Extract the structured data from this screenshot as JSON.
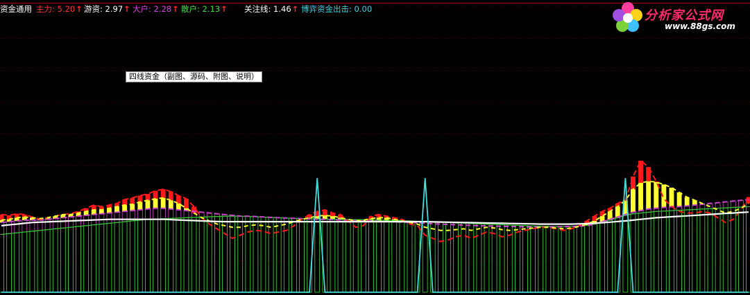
{
  "header": {
    "title": "资金通用",
    "items": [
      {
        "label": "主力: 5.20",
        "arrow": "↑",
        "color": "#ff3030"
      },
      {
        "label": "游资: 2.97",
        "arrow": "↑",
        "color": "#ffffff"
      },
      {
        "label": "大户: 2.28",
        "arrow": "↑",
        "color": "#e040e0"
      },
      {
        "label": "散户: 2.13",
        "arrow": "↑",
        "color": "#40e040"
      },
      {
        "label": "关注线: 1.46",
        "arrow": "↑",
        "color": "#ffffff"
      },
      {
        "label": "博弈资金出击: 0.00",
        "arrow": "",
        "color": "#40d0e0"
      }
    ]
  },
  "tooltip": "四线资金（副图、源码、附图、说明）",
  "logo": {
    "text": "分析家公式网",
    "url": "www.88gs.com"
  },
  "colors": {
    "main_force": "#ff1a1a",
    "hot_money": "#ffff33",
    "big_holder": "#cc44cc",
    "retail": "#33cc33",
    "watch_line": "#ffffff",
    "game_fund": "#44dddd",
    "grid": "#3a0000",
    "border": "#b00000"
  },
  "chart_data": {
    "type": "bar",
    "series": [
      {
        "name": "主力",
        "values": [
          4.9,
          4.85,
          4.95,
          4.9,
          4.75,
          4.6,
          4.7,
          4.8,
          4.9,
          4.95,
          5.1,
          5.3,
          5.5,
          5.4,
          5.5,
          5.6,
          5.85,
          5.95,
          6.1,
          6.2,
          6.4,
          6.5,
          6.35,
          6.1,
          5.9,
          5.4,
          4.7,
          4.3,
          4.0,
          3.7,
          3.4,
          3.6,
          3.8,
          3.9,
          3.85,
          3.7,
          3.8,
          3.9,
          4.2,
          4.6,
          4.9,
          5.1,
          5.2,
          5.0,
          4.9,
          4.5,
          4.1,
          4.2,
          4.8,
          4.9,
          4.8,
          4.7,
          4.6,
          4.3,
          4.2,
          3.6,
          3.4,
          3.2,
          3.3,
          3.5,
          3.6,
          3.4,
          3.6,
          3.8,
          3.7,
          3.5,
          3.6,
          3.8,
          3.9,
          4.0,
          4.1,
          4.1,
          4.0,
          3.9,
          4.0,
          4.2,
          4.5,
          4.8,
          5.1,
          5.3,
          5.6,
          5.8,
          7.3,
          8.3,
          7.9,
          7.0,
          5.9,
          5.4,
          5.1,
          5.0,
          5.0,
          5.1,
          5.0,
          4.7,
          4.4,
          4.6,
          5.2,
          6.0
        ]
      },
      {
        "name": "游资",
        "values": [
          4.55,
          4.6,
          4.7,
          4.75,
          4.7,
          4.65,
          4.7,
          4.8,
          4.9,
          4.9,
          5.0,
          5.1,
          5.2,
          5.2,
          5.3,
          5.4,
          5.5,
          5.55,
          5.7,
          5.8,
          5.9,
          5.95,
          5.8,
          5.6,
          5.3,
          5.0,
          4.7,
          4.5,
          4.3,
          4.2,
          4.1,
          4.1,
          4.2,
          4.25,
          4.2,
          4.1,
          4.2,
          4.3,
          4.45,
          4.6,
          4.7,
          4.8,
          4.85,
          4.8,
          4.7,
          4.6,
          4.5,
          4.55,
          4.65,
          4.7,
          4.7,
          4.6,
          4.5,
          4.4,
          4.3,
          4.1,
          4.0,
          3.9,
          3.9,
          3.95,
          4.0,
          3.9,
          4.0,
          4.1,
          4.05,
          3.95,
          3.9,
          3.95,
          4.0,
          4.05,
          4.1,
          4.1,
          4.05,
          4.0,
          4.05,
          4.15,
          4.3,
          4.5,
          4.8,
          5.1,
          5.4,
          5.8,
          6.5,
          6.9,
          7.0,
          6.95,
          6.8,
          6.6,
          6.3,
          6.0,
          5.8,
          5.6,
          5.4,
          5.2,
          5.0,
          5.1,
          5.3,
          5.6
        ]
      },
      {
        "name": "大户",
        "values": [
          4.4,
          4.45,
          4.5,
          4.55,
          4.55,
          4.55,
          4.6,
          4.65,
          4.7,
          4.75,
          4.8,
          4.85,
          4.9,
          4.95,
          5.0,
          5.05,
          5.1,
          5.15,
          5.2,
          5.25,
          5.3,
          5.3,
          5.25,
          5.2,
          5.15,
          5.1,
          5.05,
          5.0,
          4.95,
          4.9,
          4.85,
          4.8,
          4.8,
          4.78,
          4.75,
          4.72,
          4.7,
          4.68,
          4.66,
          4.64,
          4.62,
          4.6,
          4.6,
          4.58,
          4.56,
          4.54,
          4.52,
          4.5,
          4.5,
          4.48,
          4.46,
          4.44,
          4.42,
          4.4,
          4.38,
          4.35,
          4.32,
          4.3,
          4.28,
          4.26,
          4.24,
          4.22,
          4.2,
          4.18,
          4.17,
          4.16,
          4.15,
          4.14,
          4.13,
          4.12,
          4.12,
          4.12,
          4.13,
          4.14,
          4.15,
          4.17,
          4.2,
          4.3,
          4.45,
          4.6,
          4.75,
          4.9,
          5.05,
          5.15,
          5.25,
          5.3,
          5.35,
          5.4,
          5.4,
          5.45,
          5.5,
          5.55,
          5.6,
          5.65,
          5.7,
          5.75,
          5.8,
          5.85
        ]
      },
      {
        "name": "散户",
        "values": [
          3.65,
          3.7,
          3.75,
          3.8,
          3.85,
          3.9,
          3.95,
          4.0,
          4.05,
          4.1,
          4.15,
          4.2,
          4.25,
          4.3,
          4.35,
          4.4,
          4.45,
          4.5,
          4.55,
          4.6,
          4.62,
          4.64,
          4.66,
          4.68,
          4.7,
          4.72,
          4.74,
          4.76,
          4.78,
          4.8,
          4.8,
          4.8,
          4.78,
          4.76,
          4.74,
          4.72,
          4.7,
          4.68,
          4.66,
          4.65,
          4.64,
          4.63,
          4.62,
          4.61,
          4.6,
          4.59,
          4.58,
          4.57,
          4.56,
          4.55,
          4.54,
          4.53,
          4.52,
          4.5,
          4.48,
          4.46,
          4.44,
          4.42,
          4.4,
          4.38,
          4.36,
          4.34,
          4.32,
          4.3,
          4.28,
          4.26,
          4.24,
          4.22,
          4.2,
          4.18,
          4.17,
          4.16,
          4.15,
          4.15,
          4.16,
          4.18,
          4.22,
          4.3,
          4.4,
          4.55,
          4.7,
          4.85,
          4.95,
          5.0,
          5.05,
          5.1,
          5.12,
          5.15,
          5.17,
          5.2,
          5.22,
          5.25,
          5.27,
          5.3,
          5.32,
          5.35,
          5.37,
          5.4
        ]
      },
      {
        "name": "关注线",
        "values": [
          4.2,
          4.25,
          4.3,
          4.35,
          4.4,
          4.42,
          4.44,
          4.46,
          4.48,
          4.5,
          4.52,
          4.54,
          4.56,
          4.58,
          4.6,
          4.6,
          4.6,
          4.6,
          4.6,
          4.6,
          4.6,
          4.6,
          4.58,
          4.56,
          4.54,
          4.52,
          4.5,
          4.48,
          4.46,
          4.45,
          4.45,
          4.45,
          4.45,
          4.45,
          4.45,
          4.45,
          4.45,
          4.45,
          4.45,
          4.45,
          4.45,
          4.45,
          4.45,
          4.45,
          4.45,
          4.45,
          4.45,
          4.45,
          4.45,
          4.45,
          4.45,
          4.45,
          4.45,
          4.45,
          4.45,
          4.45,
          4.44,
          4.43,
          4.42,
          4.41,
          4.4,
          4.39,
          4.38,
          4.37,
          4.36,
          4.35,
          4.34,
          4.33,
          4.32,
          4.31,
          4.3,
          4.3,
          4.3,
          4.3,
          4.3,
          4.31,
          4.33,
          4.35,
          4.38,
          4.42,
          4.46,
          4.5,
          4.55,
          4.6,
          4.65,
          4.7,
          4.73,
          4.76,
          4.79,
          4.82,
          4.85,
          4.88,
          4.91,
          4.94,
          4.97,
          5.0,
          5.03,
          5.06
        ]
      },
      {
        "name": "博弈资金出击",
        "values": [
          0,
          0,
          0,
          0,
          0,
          0,
          0,
          0,
          0,
          0,
          0,
          0,
          0,
          0,
          0,
          0,
          0,
          0,
          0,
          0,
          0,
          0,
          0,
          0,
          0,
          0,
          0,
          0,
          0,
          0,
          0,
          0,
          0,
          0,
          0,
          0,
          0,
          0,
          0,
          0,
          0,
          7.2,
          0,
          0,
          0,
          0,
          0,
          0,
          0,
          0,
          0,
          0,
          0,
          0,
          0,
          7.2,
          0,
          0,
          0,
          0,
          0,
          0,
          0,
          0,
          0,
          0,
          0,
          0,
          0,
          0,
          0,
          0,
          0,
          0,
          0,
          0,
          0,
          0,
          0,
          0,
          0,
          7.2,
          0,
          0,
          0,
          0,
          0,
          0,
          0,
          0,
          0,
          0,
          0,
          0,
          0,
          0,
          0,
          0
        ]
      }
    ],
    "ylim": [
      0,
      18
    ],
    "grid": true
  }
}
